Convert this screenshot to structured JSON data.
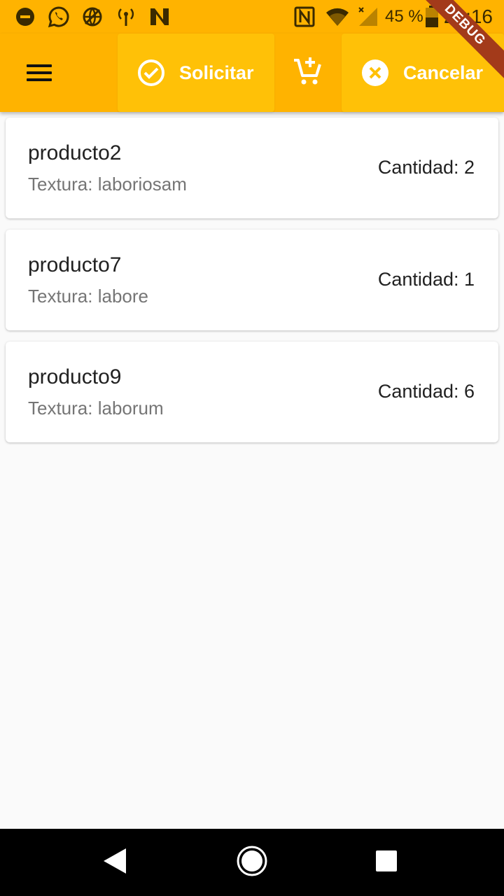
{
  "status_bar": {
    "battery_percent": "45 %",
    "time": "21:16",
    "left_icons": [
      "do-not-disturb-icon",
      "whatsapp-icon",
      "vpn-globe-icon",
      "wireless-tethering-icon",
      "n-app-icon"
    ],
    "right_icons": [
      "nfc-icon",
      "wifi-icon",
      "signal-icon",
      "battery-icon"
    ]
  },
  "app_bar": {
    "menu_icon": "hamburger-menu-icon",
    "solicitar_label": "Solicitar",
    "cart_icon": "add-to-cart-icon",
    "cancelar_label": "Cancelar",
    "debug_label": "DEBUG",
    "colors": {
      "app_bar_bg": "#ffb300",
      "button_bg": "#ffc107",
      "button_text": "#ffffff"
    }
  },
  "products": [
    {
      "name": "producto2",
      "texture": "Textura: laboriosam",
      "quantity": "Cantidad: 2"
    },
    {
      "name": "producto7",
      "texture": "Textura: labore",
      "quantity": "Cantidad: 1"
    },
    {
      "name": "producto9",
      "texture": "Textura: laborum",
      "quantity": "Cantidad: 6"
    }
  ],
  "nav_bar": {
    "icons": [
      "back-icon",
      "home-icon",
      "recents-icon"
    ]
  }
}
